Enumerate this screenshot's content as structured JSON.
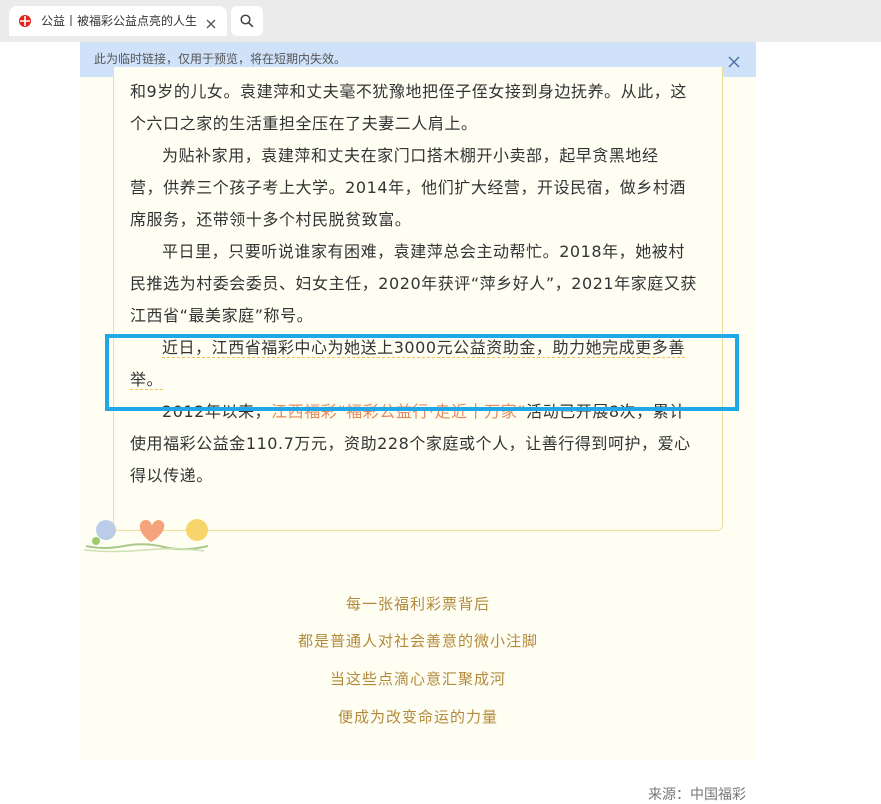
{
  "tab": {
    "title": "公益丨被福彩公益点亮的人生",
    "icon": "lottery-logo-icon"
  },
  "banner": {
    "text": "此为临时链接，仅用于预览，将在短期内失效。"
  },
  "article": {
    "p1_line1": "和9岁的儿女。袁建萍和丈夫毫不犹豫地把侄子侄女接到身边抚养。从此，这",
    "p1_line2": "个六口之家的生活重担全压在了夫妻二人肩上。",
    "p2_line1": "为贴补家用，袁建萍和丈夫在家门口搭木棚开小卖部，起早贪黑地经",
    "p2_line2": "营，供养三个孩子考上大学。2014年，他们扩大经营，开设民宿，做乡村酒",
    "p2_line3": "席服务，还带领十多个村民脱贫致富。",
    "p3_line1": "平日里，只要听说谁家有困难，袁建萍总会主动帮忙。2018年，她被村",
    "p3_line2": "民推选为村委会委员、妇女主任，2020年获评“萍乡好人”，2021年家庭又获",
    "p3_line3": "江西省“最美家庭”称号。",
    "p4_line1": "近日，江西省福彩中心为她送上3000元公益资助金，助力她完成更多善",
    "p4_line2": "举。",
    "p5_line1_a": "2012年以来，",
    "p5_line1_b": "江西福彩“福彩公益行·走近十万家”",
    "p5_line1_c": "活动已开展8次，累计",
    "p5_line2": "使用福彩公益金110.7万元，资助228个家庭或个人，让善行得到呵护，爱心",
    "p5_line3": "得以传递。"
  },
  "slogans": [
    "每一张福利彩票背后",
    "都是普通人对社会善意的微小注脚",
    "当这些点滴心意汇聚成河",
    "便成为改变命运的力量"
  ],
  "source": "来源：中国福彩",
  "colors": {
    "highlight_box": "#1fa7e8",
    "link_orange": "#e58a5b",
    "slogan": "#b38a3c",
    "page_bg": "#fffef3",
    "banner_bg": "#cfe2fa"
  }
}
